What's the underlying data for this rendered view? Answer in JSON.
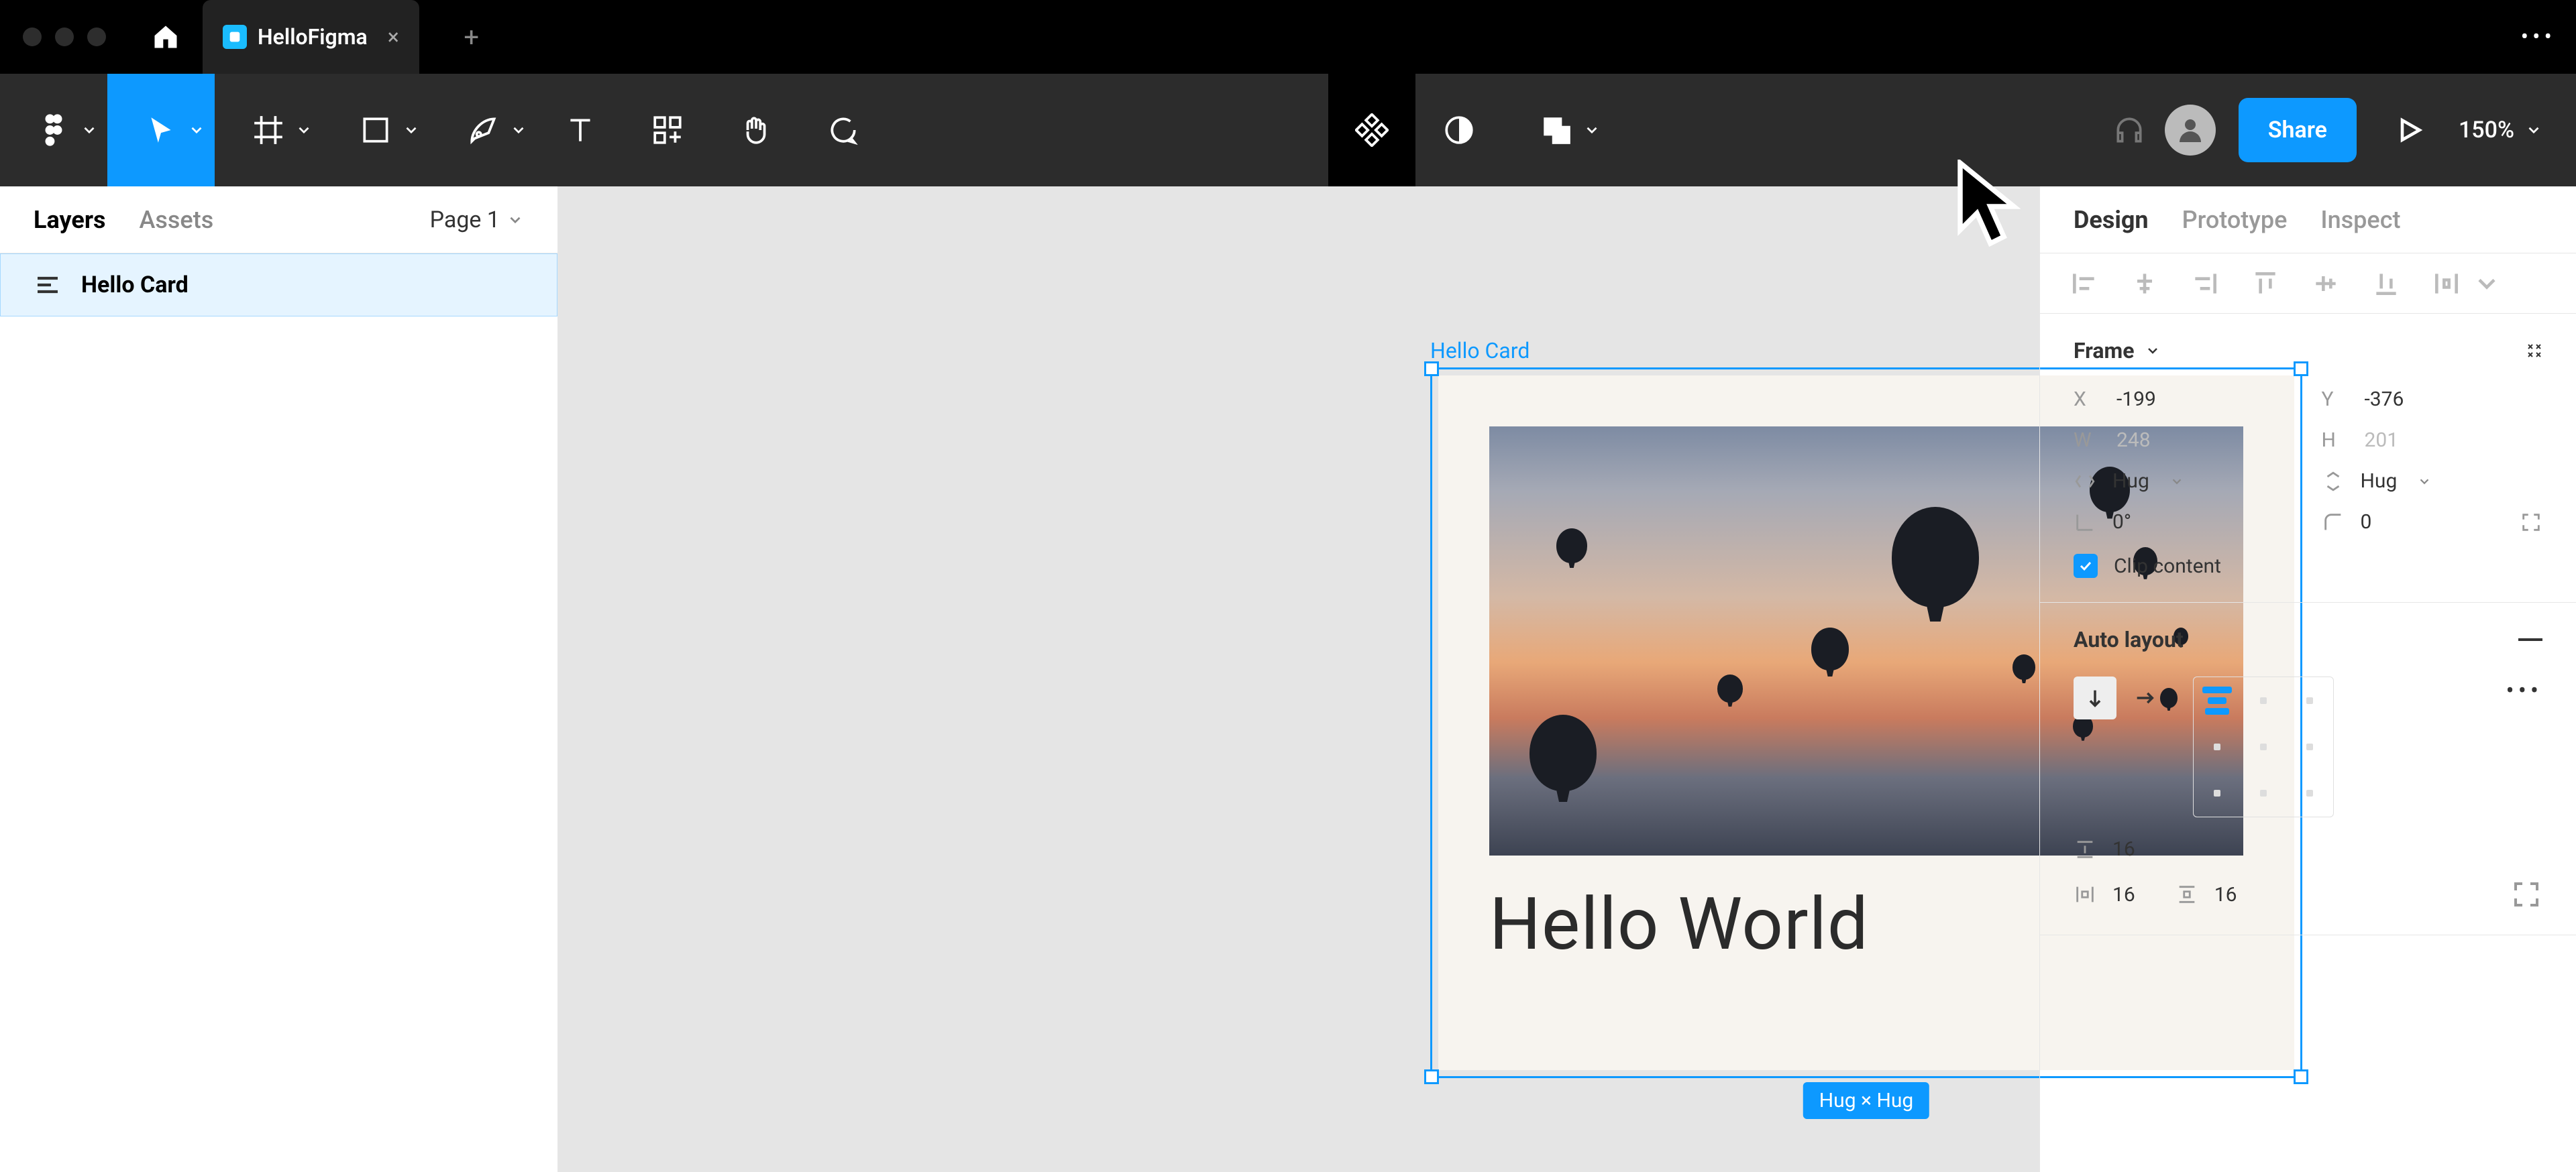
{
  "title_bar": {
    "tab_title": "HelloFigma"
  },
  "toolbar": {
    "share_label": "Share",
    "zoom": "150%"
  },
  "left_panel": {
    "tabs": {
      "layers": "Layers",
      "assets": "Assets"
    },
    "page_selector": "Page 1",
    "layers": [
      {
        "name": "Hello Card"
      }
    ]
  },
  "canvas": {
    "frame_label": "Hello Card",
    "card_text": "Hello World",
    "hug_badge": "Hug × Hug"
  },
  "right_panel": {
    "tabs": {
      "design": "Design",
      "prototype": "Prototype",
      "inspect": "Inspect"
    },
    "frame": {
      "title": "Frame",
      "x": "-199",
      "y": "-376",
      "w": "248",
      "h": "201",
      "wmode": "Hug",
      "hmode": "Hug",
      "rotation": "0°",
      "radius": "0",
      "clip_label": "Clip content"
    },
    "auto_layout": {
      "title": "Auto layout",
      "gap": "16",
      "pad_h": "16",
      "pad_v": "16"
    }
  }
}
